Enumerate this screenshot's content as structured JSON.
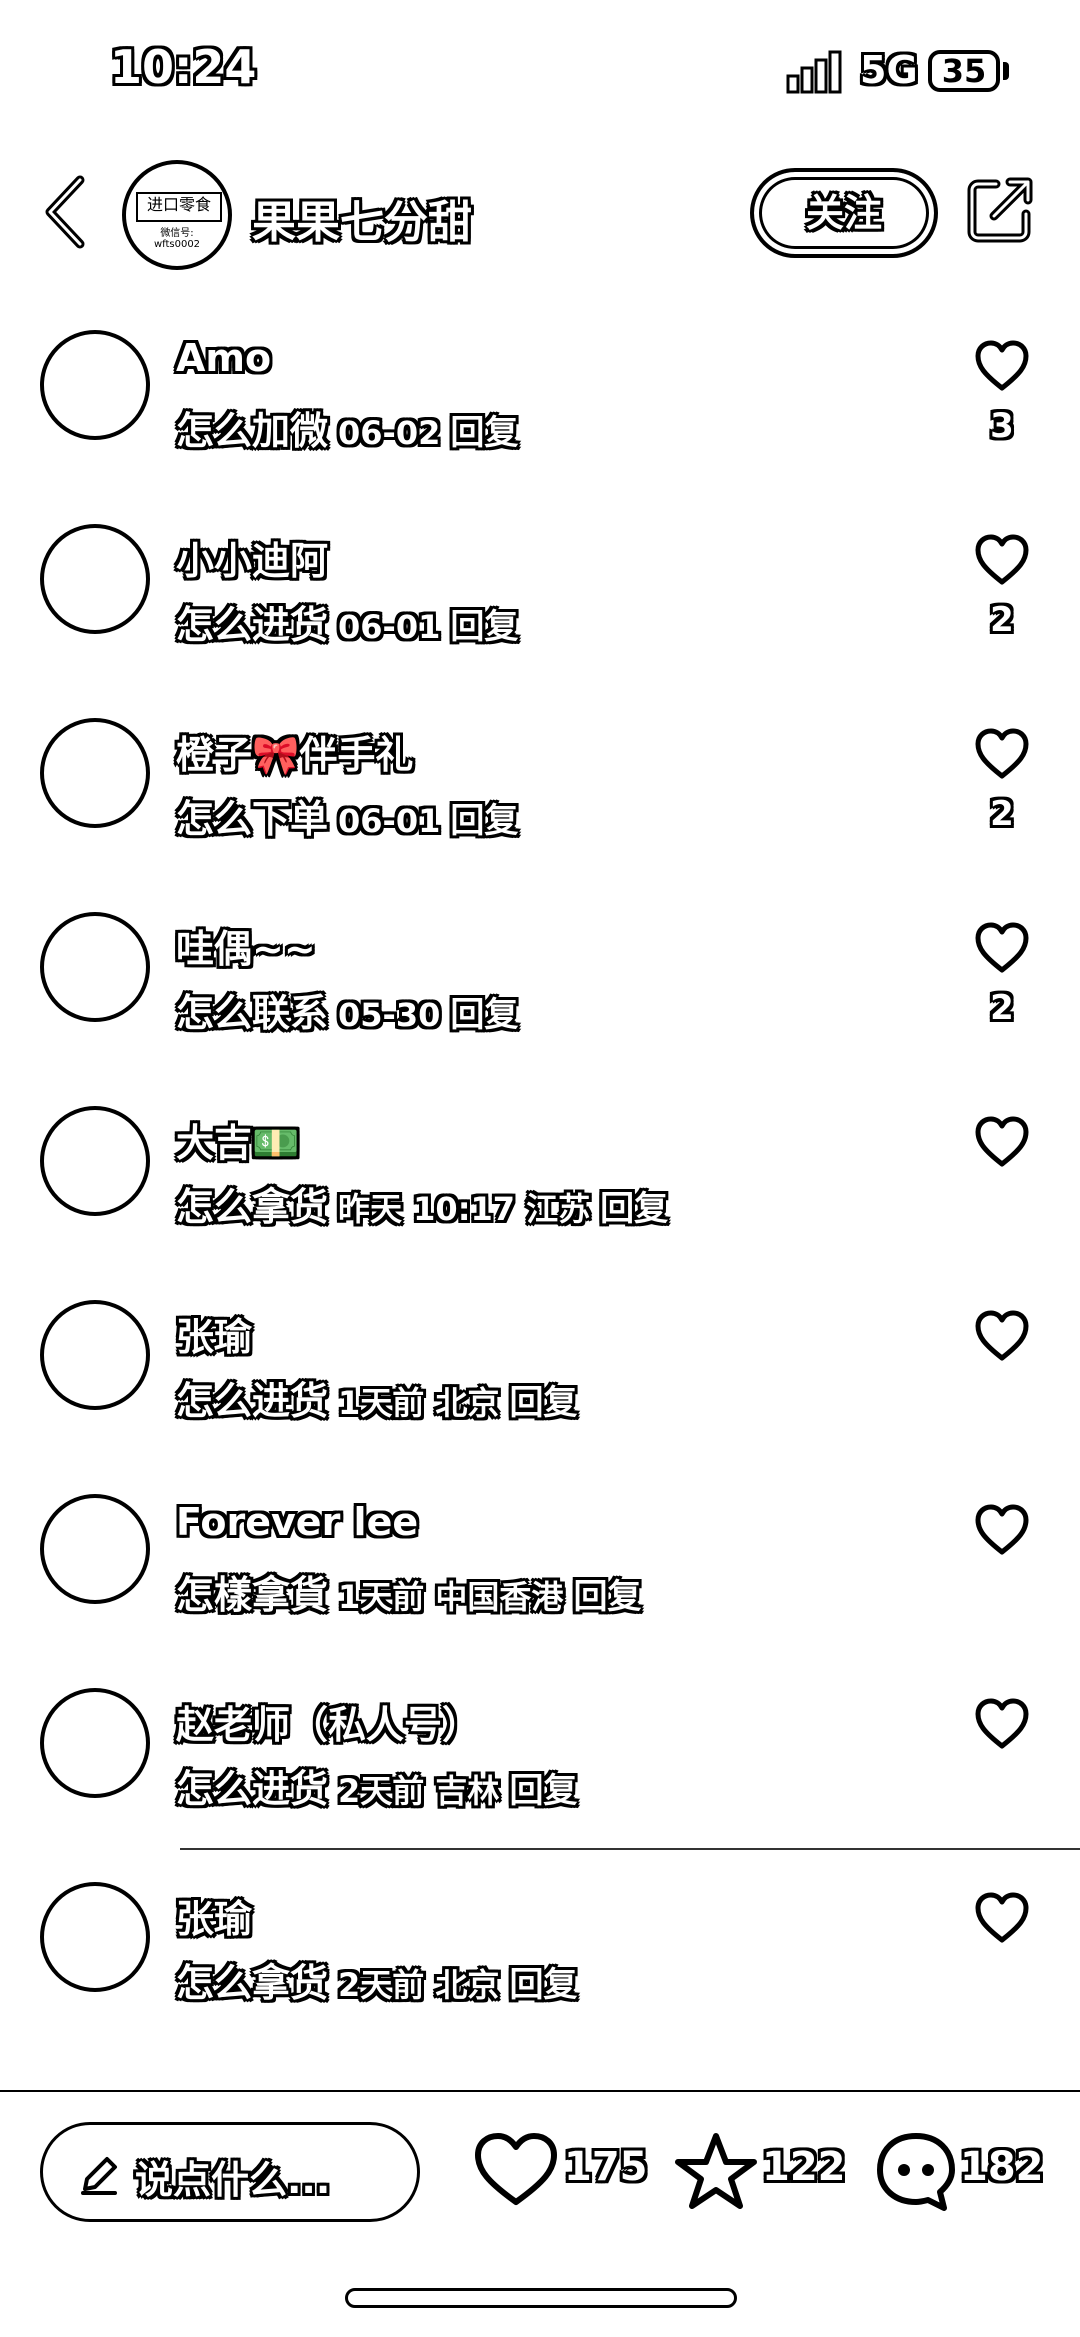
{
  "status_bar": {
    "time": "10:24",
    "network": "5G",
    "battery": "35"
  },
  "header": {
    "account_name": "果果七分甜",
    "follow_label": "关注",
    "avatar_logo_text": "进口零食",
    "avatar_logo_sub": "微信号: wfts0002"
  },
  "comments": [
    {
      "name": "Amo",
      "text": "怎么加微",
      "meta": "06-02",
      "reply": "回复",
      "likes": "3"
    },
    {
      "name": "小小迪阿",
      "text": "怎么进货",
      "meta": "06-01",
      "reply": "回复",
      "likes": "2"
    },
    {
      "name": "橙子🎀伴手礼",
      "text": "怎么下单",
      "meta": "06-01",
      "reply": "回复",
      "likes": "2"
    },
    {
      "name": "哇偶~~",
      "text": "怎么联系",
      "meta": "05-30",
      "reply": "回复",
      "likes": "2"
    },
    {
      "name": "大吉💵",
      "text": "怎么拿货",
      "meta": "昨天 10:17 江苏",
      "reply": "回复",
      "likes": ""
    },
    {
      "name": "张瑜",
      "text": "怎么进货",
      "meta": "1天前 北京",
      "reply": "回复",
      "likes": ""
    },
    {
      "name": "Forever lee",
      "text": "怎樣拿貨",
      "meta": "1天前 中国香港",
      "reply": "回复",
      "likes": ""
    },
    {
      "name": "赵老师（私人号）",
      "text": "怎么进货",
      "meta": "2天前 吉林",
      "reply": "回复",
      "likes": ""
    },
    {
      "name": "张瑜",
      "text": "怎么拿货",
      "meta": "2天前 北京",
      "reply": "回复",
      "likes": ""
    }
  ],
  "bottom_bar": {
    "placeholder": "说点什么...",
    "likes": "175",
    "stars": "122",
    "comments": "182"
  },
  "icons": [
    "back-icon",
    "share-icon",
    "heart-icon",
    "pen-icon",
    "star-icon",
    "comment-icon"
  ]
}
